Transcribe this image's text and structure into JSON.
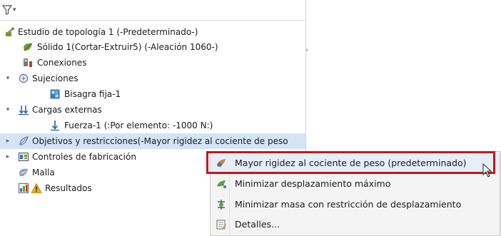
{
  "tree": {
    "root": {
      "label": "Estudio de topología 1 (-Predeterminado-)",
      "icon": "study-icon"
    },
    "items": [
      {
        "label": "Sólido 1(Cortar-Extruir5) (-Aleación 1060-)",
        "icon": "solid-body-icon"
      },
      {
        "label": "Conexiones",
        "icon": "connections-icon"
      },
      {
        "label": "Sujeciones",
        "icon": "fixtures-icon",
        "expander": "▾"
      },
      {
        "label": "Bisagra fija-1",
        "icon": "fixed-hinge-icon"
      },
      {
        "label": "Cargas externas",
        "icon": "external-loads-icon",
        "expander": "▾"
      },
      {
        "label": "Fuerza-1 (:Por elemento: -1000 N:)",
        "icon": "force-icon"
      },
      {
        "label": "Objetivos y restricciones(-Mayor rigidez al cociente de peso",
        "icon": "goals-icon",
        "expander": "▸"
      },
      {
        "label": "Controles de fabricación",
        "icon": "manufacturing-controls-icon",
        "expander": "▸"
      },
      {
        "label": "Malla",
        "icon": "mesh-icon"
      },
      {
        "label": "Resultados",
        "icon": "results-icon"
      }
    ]
  },
  "context_menu": {
    "items": [
      {
        "label": "Mayor rigidez al cociente de peso (predeterminado)",
        "icon": "stiffness-weight-icon"
      },
      {
        "label": "Minimizar desplazamiento máximo",
        "icon": "minimize-displacement-icon"
      },
      {
        "label": "Minimizar masa con restricción de desplazamiento",
        "icon": "minimize-mass-icon"
      },
      {
        "label": "Detalles...",
        "icon": "details-icon"
      }
    ]
  },
  "colors": {
    "selection": "#d3e4f7",
    "highlight_border": "#c4161c",
    "menu_background": "#f4f4f4"
  }
}
